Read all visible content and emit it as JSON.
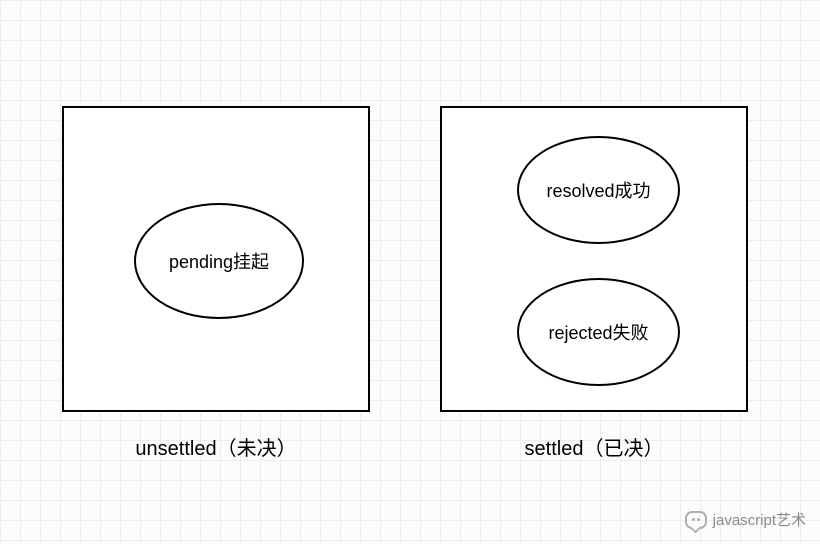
{
  "diagram": {
    "left": {
      "caption": "unsettled（未决）",
      "states": {
        "pending": "pending挂起"
      }
    },
    "right": {
      "caption": "settled（已决）",
      "states": {
        "resolved": "resolved成功",
        "rejected": "rejected失败"
      }
    }
  },
  "watermark": {
    "text": "javascript艺术"
  }
}
